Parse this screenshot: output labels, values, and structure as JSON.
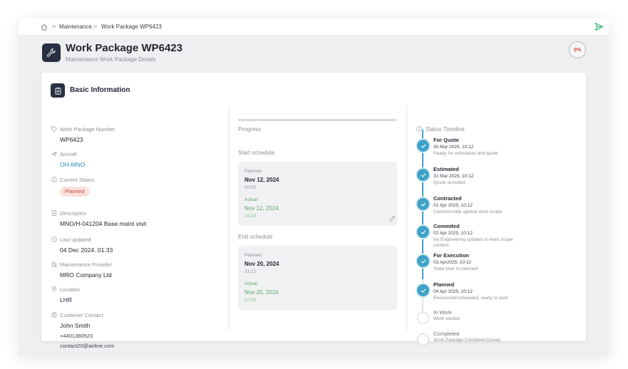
{
  "breadcrumb": {
    "items": [
      "Maintenance",
      "Work Package WP6423"
    ],
    "separator": ">"
  },
  "header": {
    "title": "Work Package WP6423",
    "subtitle": "Maintenance Work Package Details",
    "progress_label": "0%",
    "progress_value": 0
  },
  "card": {
    "title": "Basic Information"
  },
  "fields": [
    {
      "label": "Work Package Number",
      "value": "WP6423",
      "icon": "tag-icon"
    },
    {
      "label": "Aircraft",
      "value": "OH-MNO",
      "icon": "plane-icon"
    },
    {
      "label": "Current Status",
      "value": "Planned",
      "icon": "info-icon"
    },
    {
      "label": "Description",
      "value": "MNO/H-041204 Base maint visit",
      "icon": "document-icon"
    },
    {
      "label": "Last updated",
      "value": "04 Dec 2024. 01:33",
      "icon": "clock-icon"
    },
    {
      "label": "Maintenance Provider",
      "value": "MRO Company Ltd",
      "icon": "building-icon"
    },
    {
      "label": "Location",
      "value": "LHR",
      "icon": "location-icon"
    },
    {
      "label": "Customer Contact",
      "value": "John Smith",
      "icon": "user-icon"
    }
  ],
  "contact": {
    "phone": "+4401360523",
    "email": "contact20@airline.com"
  },
  "progress": {
    "label": "Progress",
    "value": 0
  },
  "schedule": {
    "start": {
      "label": "Start schedule",
      "planned_label": "Planned",
      "planned_date": "Nov 12, 2024",
      "planned_time": "00:02",
      "actual_label": "Actual",
      "actual_date": "Nov 12, 2024",
      "actual_time": "15:23"
    },
    "end": {
      "label": "End schedule",
      "planned_label": "Planned",
      "planned_date": "Nov 20, 2024",
      "planned_time": "21:12",
      "actual_label": "Actual",
      "actual_date": "Nov 20, 2024",
      "actual_time": "02:55"
    }
  },
  "timeline": {
    "label": "Status Timeline",
    "steps": [
      {
        "title": "For Quote",
        "date": "30 Mar 2025, 10:12",
        "desc": "Ready for estimation and quote",
        "done": true
      },
      {
        "title": "Estimated",
        "date": "31 Mar 2025, 10:12",
        "desc": "Quote provided",
        "done": true
      },
      {
        "title": "Contracted",
        "date": "01 Apr 2025, 10:12",
        "desc": "Commercially agreed work scope",
        "done": true
      },
      {
        "title": "Commited",
        "date": "02 Apr 2025, 10:12",
        "desc": "No Engineering updates to work scope content",
        "done": true
      },
      {
        "title": "For Execution",
        "date": "03 Apr2025, 10:12",
        "desc": "State prior to planned",
        "done": true
      },
      {
        "title": "Planned",
        "date": "04 Apr 2025, 10:12",
        "desc": "Resourced/scheduled, ready to start",
        "done": true
      },
      {
        "title": "In Work",
        "date": "",
        "desc": "Work started",
        "done": false
      },
      {
        "title": "Completed",
        "date": "",
        "desc": "Work Package Complete/Closed",
        "done": false
      }
    ]
  },
  "colors": {
    "accent": "#3fa3c8",
    "dark": "#283042",
    "status_bg": "#fbe0dd",
    "status_text": "#d24a3a",
    "actual_green": "#5aa86a",
    "send_green": "#3cb46e"
  }
}
